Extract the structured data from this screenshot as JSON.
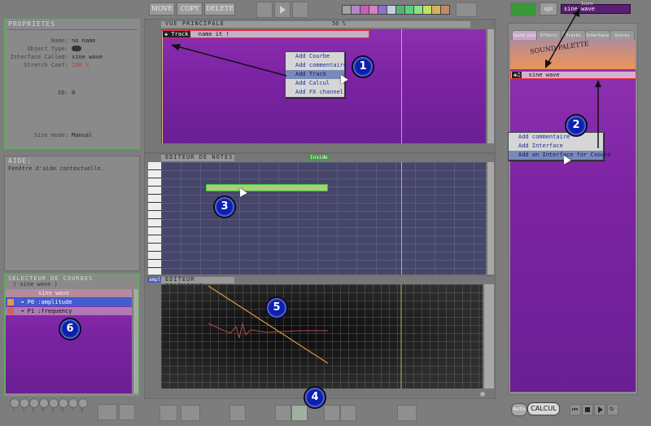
{
  "toolbar": {
    "move_label": "MOVE",
    "copy_label": "COPY",
    "delete_label": "DELETE"
  },
  "palette_colors": [
    "#a3a3a3",
    "#b388c9",
    "#c95fb1",
    "#d97fc3",
    "#8b6fd1",
    "#c0d0e0",
    "#55b07a",
    "#5fcf85",
    "#8ee08b",
    "#c9dd62",
    "#d2b55b",
    "#c48b63"
  ],
  "properties": {
    "title": "PROPRIETES",
    "rows": [
      {
        "label": "Name:",
        "value": "no name"
      },
      {
        "label": "Object Type:",
        "value": ""
      },
      {
        "label": "Interface Called:",
        "value": "sine wave"
      },
      {
        "label": "Stretch Coef:",
        "value": "100 %"
      },
      {
        "label": "DB:",
        "value": "0"
      },
      {
        "label": "Size mode:",
        "value": "Manual"
      }
    ]
  },
  "help": {
    "title": "AIDE:",
    "text": "Fenêtre d'aide contextuelle."
  },
  "curve_selector": {
    "title": "SELECTEUR DE COURBES",
    "subtitle": "( sine wave )",
    "header_label": "sine wave",
    "rows": [
      {
        "label": "P0 :amplitude"
      },
      {
        "label": "P1 :frequency"
      }
    ]
  },
  "main_view": {
    "title": "VUE PRINCIPALE",
    "zoom": "50 %",
    "track_tag": "Track",
    "track_name": "name it !"
  },
  "context_menu_1": {
    "items": [
      "Add Courbe",
      "Add commentaire",
      "Add Track",
      "Add Calcul",
      "Add FX channel"
    ],
    "selected": 2
  },
  "note_editor": {
    "title": "EDITEUR DE NOTES",
    "inside_tag": "Inside"
  },
  "graph_editor": {
    "title": "EDITEUR GRAPHIQUE",
    "tab_label": "ampl"
  },
  "sound_palette": {
    "title": "SOUND PALETTE",
    "tabs": [
      "Sound palette",
      "Effects",
      "Tracks",
      "Interfaces",
      "Scores"
    ],
    "header_field": "sine wave",
    "item_label": "sine wave",
    "spl_label": "spl",
    "top_small": "Icons"
  },
  "context_menu_2": {
    "items": [
      "Add commentaire",
      "Add Interface",
      "Add an Interface for Csound"
    ],
    "selected": 2
  },
  "badges": [
    "1",
    "2",
    "3",
    "4",
    "5",
    "6"
  ],
  "transport": {
    "auto_label": "Auto",
    "calcul_label": "CALCUL"
  },
  "page_numbers": [
    "1",
    "2",
    "3",
    "4",
    "5",
    "6",
    "7",
    "8"
  ]
}
